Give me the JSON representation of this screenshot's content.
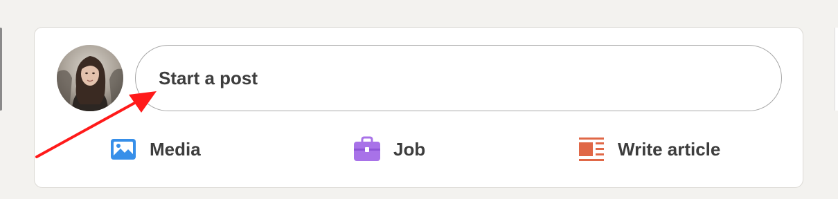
{
  "composer": {
    "placeholder": "Start a post",
    "avatar_icon": "user-photo"
  },
  "actions": [
    {
      "label": "Media",
      "icon": "image-icon",
      "color": "#378fe9"
    },
    {
      "label": "Job",
      "icon": "briefcase-icon",
      "color": "#a872e8"
    },
    {
      "label": "Write article",
      "icon": "article-icon",
      "color": "#e06847"
    }
  ],
  "annotation": {
    "arrow_color": "#ff1a1a"
  }
}
